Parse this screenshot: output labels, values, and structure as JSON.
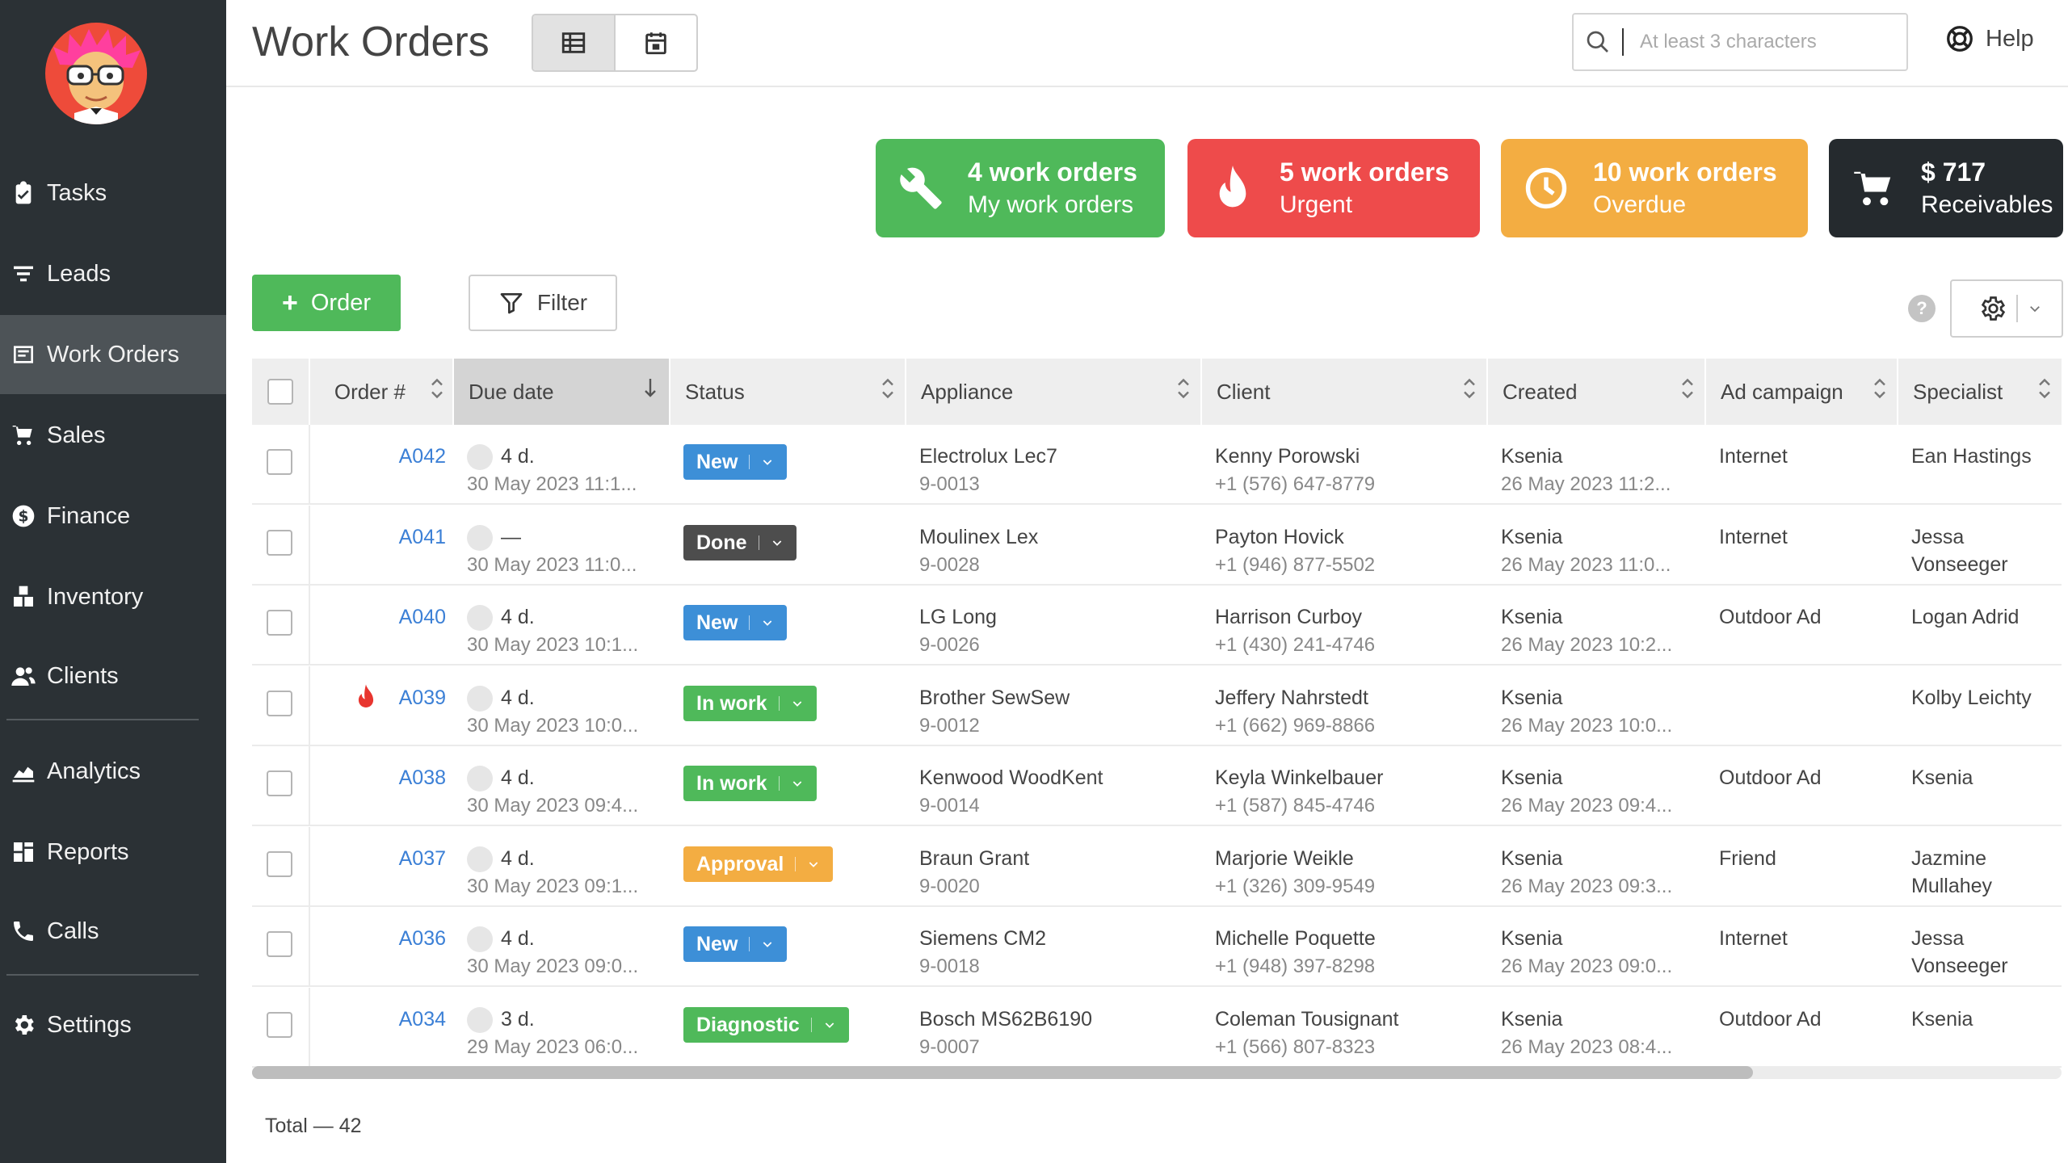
{
  "colors": {
    "sidebar": "#2b3135",
    "green": "#4fb95a",
    "red": "#ee4b4b",
    "orange": "#f3ad42",
    "dark": "#252a2e",
    "blue": "#3c80d6",
    "status_new": "#3d8fd7",
    "status_done": "#4d4d4d",
    "status_approval": "#f3ad42"
  },
  "sidebar": {
    "items": [
      {
        "label": "Tasks",
        "icon": "clipboard-icon"
      },
      {
        "label": "Leads",
        "icon": "funnel-icon"
      },
      {
        "label": "Work Orders",
        "icon": "work-orders-icon",
        "active": true
      },
      {
        "label": "Sales",
        "icon": "cart-icon"
      },
      {
        "label": "Finance",
        "icon": "dollar-icon"
      },
      {
        "label": "Inventory",
        "icon": "boxes-icon"
      },
      {
        "label": "Clients",
        "icon": "users-icon"
      },
      {
        "label": "Analytics",
        "icon": "chart-icon"
      },
      {
        "label": "Reports",
        "icon": "reports-icon"
      },
      {
        "label": "Calls",
        "icon": "phone-icon"
      },
      {
        "label": "Settings",
        "icon": "gear-icon"
      }
    ]
  },
  "header": {
    "title": "Work Orders",
    "search_placeholder": "At least 3 characters",
    "help_label": "Help"
  },
  "cards": [
    {
      "main": "4 work orders",
      "sub": "My work orders",
      "icon": "wrench-icon"
    },
    {
      "main": "5 work orders",
      "sub": "Urgent",
      "icon": "flame-icon"
    },
    {
      "main": "10 work orders",
      "sub": "Overdue",
      "icon": "clock-icon"
    },
    {
      "main": "$ 717",
      "sub": "Receivables",
      "icon": "cart-icon"
    }
  ],
  "toolbar": {
    "order_label": "Order",
    "filter_label": "Filter",
    "help_mark": "?"
  },
  "table": {
    "columns": [
      "Order #",
      "Due date",
      "Status",
      "Appliance",
      "Client",
      "Created",
      "Ad campaign",
      "Specialist"
    ],
    "rows": [
      {
        "order": "A042",
        "due": "4 d.",
        "due_date": "30 May 2023 11:1...",
        "status": "New",
        "status_color": "#3d8fd7",
        "appliance": "Electrolux Lec7",
        "serial": "9-0013",
        "client": "Kenny Porowski",
        "phone": "+1 (576) 647-8779",
        "created_by": "Ksenia",
        "created": "26 May 2023 11:2...",
        "campaign": "Internet",
        "specialist": "Ean Hastings",
        "specialist2": "",
        "urgent": false
      },
      {
        "order": "A041",
        "due": "—",
        "due_date": "30 May 2023 11:0...",
        "status": "Done",
        "status_color": "#4d4d4d",
        "appliance": "Moulinex Lex",
        "serial": "9-0028",
        "client": "Payton Hovick",
        "phone": "+1 (946) 877-5502",
        "created_by": "Ksenia",
        "created": "26 May 2023 11:0...",
        "campaign": "Internet",
        "specialist": "Jessa",
        "specialist2": "Vonseeger",
        "urgent": false
      },
      {
        "order": "A040",
        "due": "4 d.",
        "due_date": "30 May 2023 10:1...",
        "status": "New",
        "status_color": "#3d8fd7",
        "appliance": "LG Long",
        "serial": "9-0026",
        "client": "Harrison Curboy",
        "phone": "+1 (430) 241-4746",
        "created_by": "Ksenia",
        "created": "26 May 2023 10:2...",
        "campaign": "Outdoor Ad",
        "specialist": "Logan Adrid",
        "specialist2": "",
        "urgent": false
      },
      {
        "order": "A039",
        "due": "4 d.",
        "due_date": "30 May 2023 10:0...",
        "status": "In work",
        "status_color": "#4fb95a",
        "appliance": "Brother SewSew",
        "serial": "9-0012",
        "client": "Jeffery Nahrstedt",
        "phone": "+1 (662) 969-8866",
        "created_by": "Ksenia",
        "created": "26 May 2023 10:0...",
        "campaign": "",
        "specialist": "Kolby Leichty",
        "specialist2": "",
        "urgent": true
      },
      {
        "order": "A038",
        "due": "4 d.",
        "due_date": "30 May 2023 09:4...",
        "status": "In work",
        "status_color": "#4fb95a",
        "appliance": "Kenwood WoodKent",
        "serial": "9-0014",
        "client": "Keyla Winkelbauer",
        "phone": "+1 (587) 845-4746",
        "created_by": "Ksenia",
        "created": "26 May 2023 09:4...",
        "campaign": "Outdoor Ad",
        "specialist": "Ksenia",
        "specialist2": "",
        "urgent": false
      },
      {
        "order": "A037",
        "due": "4 d.",
        "due_date": "30 May 2023 09:1...",
        "status": "Approval",
        "status_color": "#f3ad42",
        "appliance": "Braun Grant",
        "serial": "9-0020",
        "client": "Marjorie Weikle",
        "phone": "+1 (326) 309-9549",
        "created_by": "Ksenia",
        "created": "26 May 2023 09:3...",
        "campaign": "Friend",
        "specialist": "Jazmine",
        "specialist2": "Mullahey",
        "urgent": false
      },
      {
        "order": "A036",
        "due": "4 d.",
        "due_date": "30 May 2023 09:0...",
        "status": "New",
        "status_color": "#3d8fd7",
        "appliance": "Siemens CM2",
        "serial": "9-0018",
        "client": "Michelle Poquette",
        "phone": "+1 (948) 397-8298",
        "created_by": "Ksenia",
        "created": "26 May 2023 09:0...",
        "campaign": "Internet",
        "specialist": "Jessa",
        "specialist2": "Vonseeger",
        "urgent": false
      },
      {
        "order": "A034",
        "due": "3 d.",
        "due_date": "29 May 2023 06:0...",
        "status": "Diagnostic",
        "status_color": "#4fb95a",
        "appliance": "Bosch MS62B6190",
        "serial": "9-0007",
        "client": "Coleman Tousignant",
        "phone": "+1 (566) 807-8323",
        "created_by": "Ksenia",
        "created": "26 May 2023 08:4...",
        "campaign": "Outdoor Ad",
        "specialist": "Ksenia",
        "specialist2": "",
        "urgent": false
      }
    ]
  },
  "footer": {
    "total": "Total — 42"
  }
}
